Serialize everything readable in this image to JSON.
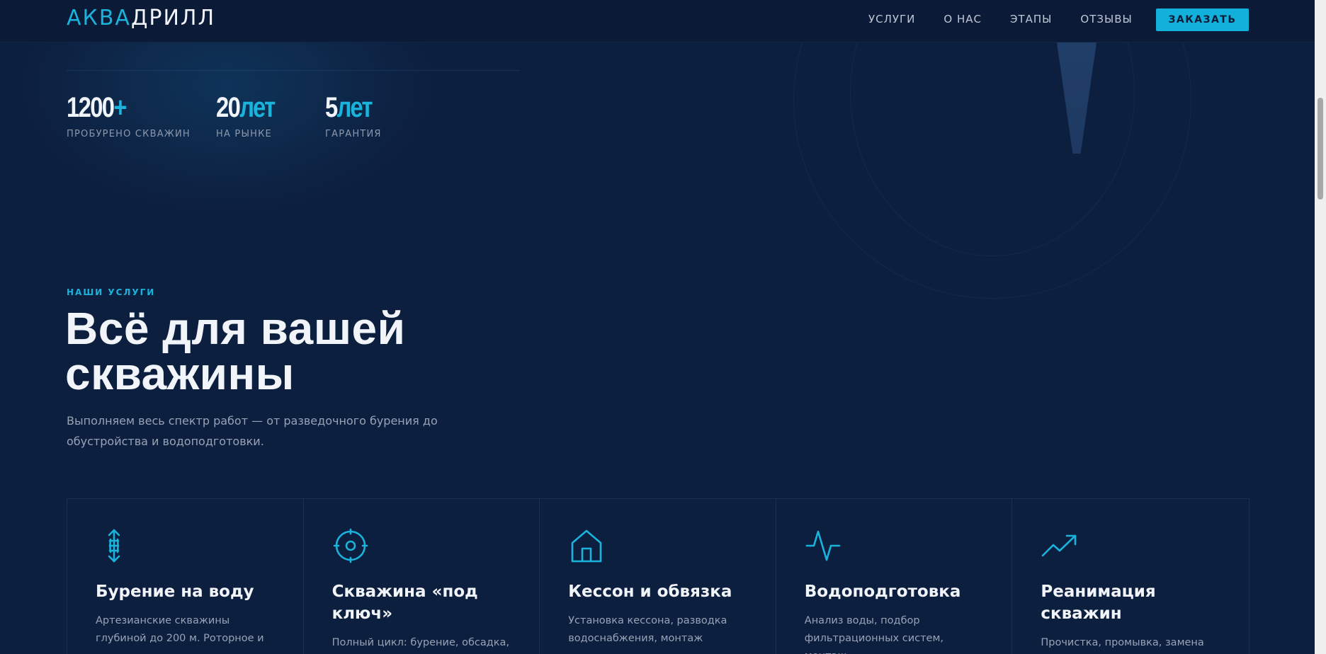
{
  "header": {
    "logo_part1": "АКВА",
    "logo_part2": "ДРИЛЛ",
    "nav": [
      "УСЛУГИ",
      "О НАС",
      "ЭТАПЫ",
      "ОТЗЫВЫ"
    ],
    "cta_label": "ЗАКАЗАТЬ"
  },
  "stats": [
    {
      "value": "1200",
      "accent": "+",
      "label": "ПРОБУРЕНО СКВАЖИН"
    },
    {
      "value": "20",
      "accent": "лет",
      "label": "НА РЫНКЕ"
    },
    {
      "value": "5",
      "accent": "лет",
      "label": "ГАРАНТИЯ"
    }
  ],
  "services": {
    "eyebrow": "НАШИ УСЛУГИ",
    "title_line1": "Всё для вашей",
    "title_line2": "скважины",
    "lead": "Выполняем весь спектр работ — от разведочного бурения до обустройства и водоподготовки.",
    "cards": [
      {
        "icon": "vertical-arrows-icon",
        "title": "Бурение на воду",
        "desc": "Артезианские скважины глубиной до 200 м. Роторное и"
      },
      {
        "icon": "target-icon",
        "title": "Скважина «под ключ»",
        "desc": "Полный цикл: бурение, обсадка,"
      },
      {
        "icon": "house-icon",
        "title": "Кессон и обвязка",
        "desc": "Установка кессона, разводка водоснабжения, монтаж"
      },
      {
        "icon": "pulse-icon",
        "title": "Водоподготовка",
        "desc": "Анализ воды, подбор фильтрационных систем, монтаж"
      },
      {
        "icon": "trending-up-icon",
        "title": "Реанимация скважин",
        "desc": "Прочистка, промывка, замена"
      }
    ]
  },
  "colors": {
    "accent": "#19b3dc",
    "background": "#0d1f3f",
    "header": "#0b1a36"
  }
}
